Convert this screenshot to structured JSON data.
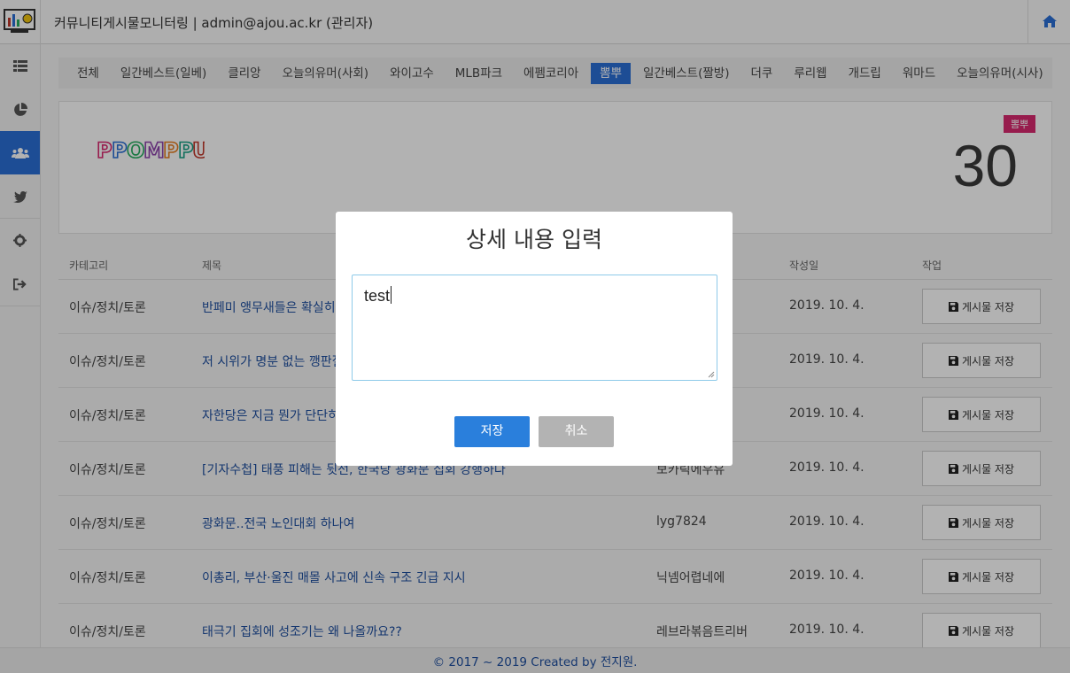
{
  "header": {
    "title": "커뮤니티게시물모니터링 | admin@ajou.ac.kr (관리자)"
  },
  "sidebar": {
    "items": [
      {
        "icon": "list-icon"
      },
      {
        "icon": "pie-chart-icon"
      },
      {
        "icon": "users-icon",
        "active": true
      },
      {
        "icon": "twitter-icon"
      },
      {
        "icon": "gear-icon"
      },
      {
        "icon": "sign-out-icon"
      }
    ]
  },
  "tabs": [
    "전체",
    "일간베스트(일베)",
    "클리앙",
    "오늘의유머(사회)",
    "와이고수",
    "MLB파크",
    "에펨코리아",
    "뽐뿌",
    "일간베스트(짤방)",
    "더쿠",
    "루리웹",
    "개드립",
    "워마드",
    "오늘의유머(시사)"
  ],
  "active_tab": "뽐뿌",
  "site_card": {
    "logo_text": "PPOMPPU",
    "badge": "뽐뿌",
    "count": "30"
  },
  "table": {
    "headers": {
      "category": "카테고리",
      "title": "제목",
      "date": "작성일",
      "action": "작업"
    },
    "rows": [
      {
        "category": "이슈/정치/토론",
        "title": "반페미 앵무새들은 확실히 천",
        "author": "",
        "date": "2019. 10. 4.",
        "action": "게시물 저장"
      },
      {
        "category": "이슈/정치/토론",
        "title": "저 시위가 명분 없는 깽판질",
        "author": "",
        "date": "2019. 10. 4.",
        "action": "게시물 저장"
      },
      {
        "category": "이슈/정치/토론",
        "title": "자한당은 지금 뭔가 단단히",
        "author": "",
        "date": "2019. 10. 4.",
        "action": "게시물 저장"
      },
      {
        "category": "이슈/정치/토론",
        "title": "[기자수첩] 태풍 피해는 뒷전, 한국당 광화문 집회 강행하다",
        "author": "보카릭에우유",
        "date": "2019. 10. 4.",
        "action": "게시물 저장"
      },
      {
        "category": "이슈/정치/토론",
        "title": "광화문..전국 노인대회 하나여",
        "author": "lyg7824",
        "date": "2019. 10. 4.",
        "action": "게시물 저장"
      },
      {
        "category": "이슈/정치/토론",
        "title": "이총리, 부산·울진 매몰 사고에 신속 구조 긴급 지시",
        "author": "닉넴어렵네에",
        "date": "2019. 10. 4.",
        "action": "게시물 저장"
      },
      {
        "category": "이슈/정치/토론",
        "title": "태극기 집회에 성조기는 왜 나올까요??",
        "author": "레브라볶음트리버",
        "date": "2019. 10. 4.",
        "action": "게시물 저장"
      }
    ]
  },
  "footer": {
    "text": "© 2017 ~ 2019 Created by 전지원."
  },
  "modal": {
    "title": "상세 내용 입력",
    "textarea_value": "test",
    "save_label": "저장",
    "cancel_label": "취소"
  },
  "colors": {
    "accent": "#2a6fd6",
    "badge": "#d8296f",
    "link": "#1f4fa0",
    "cancel": "#b3b3b3"
  }
}
